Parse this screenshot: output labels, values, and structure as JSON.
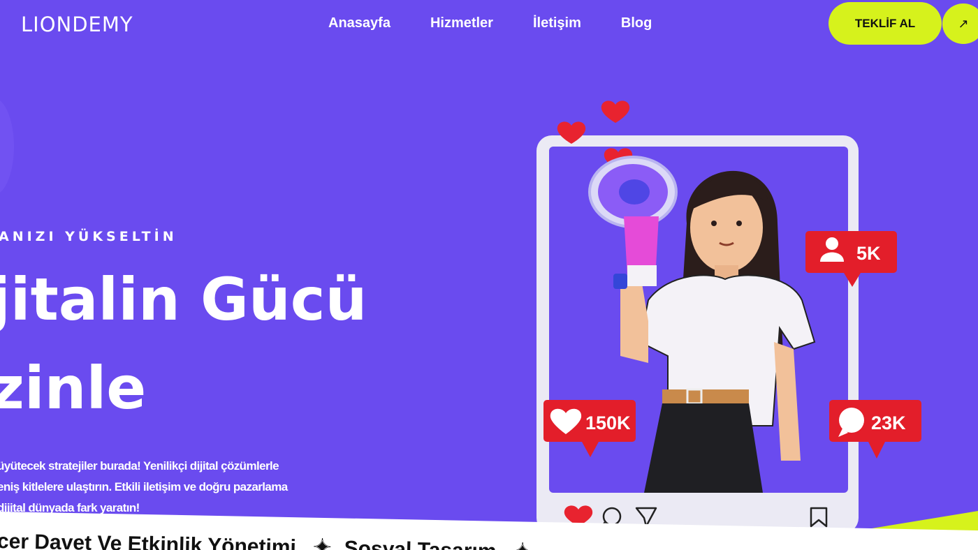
{
  "brand": {
    "logo_text": "LIONDEMY"
  },
  "nav": {
    "links": [
      "Anasayfa",
      "Hizmetler",
      "İletişim",
      "Blog"
    ],
    "cta_label": "TEKLİF AL",
    "cta_arrow": "↗"
  },
  "hero": {
    "eyebrow": "ANIZI YÜKSELTİN",
    "headline_line1": "jitalin Gücü",
    "headline_line2": "zinle",
    "desc_line1": "üyütecek stratejiler burada! Yenilikçi dijital çözümlerle",
    "desc_line2": "eniş kitlelere ulaştırın. Etkili iletişim ve doğru pazarlama",
    "desc_line3": "dijital dünyada fark yaratın!"
  },
  "social": {
    "followers": "5K",
    "likes": "150K",
    "comments": "23K"
  },
  "marquee": {
    "item1": "cer Davet Ve Etkinlik Yönetimi",
    "item2": "Sosyal Tasarım"
  },
  "colors": {
    "background": "#6a4bef",
    "accent": "#d6f21c",
    "badge_red": "#e31e2a",
    "heart": "#e8232f"
  },
  "icons": [
    "logo-lion-icon",
    "arrow-up-right-icon",
    "heart-icon",
    "comment-icon",
    "send-icon",
    "bookmark-icon",
    "user-icon",
    "star-icon"
  ]
}
